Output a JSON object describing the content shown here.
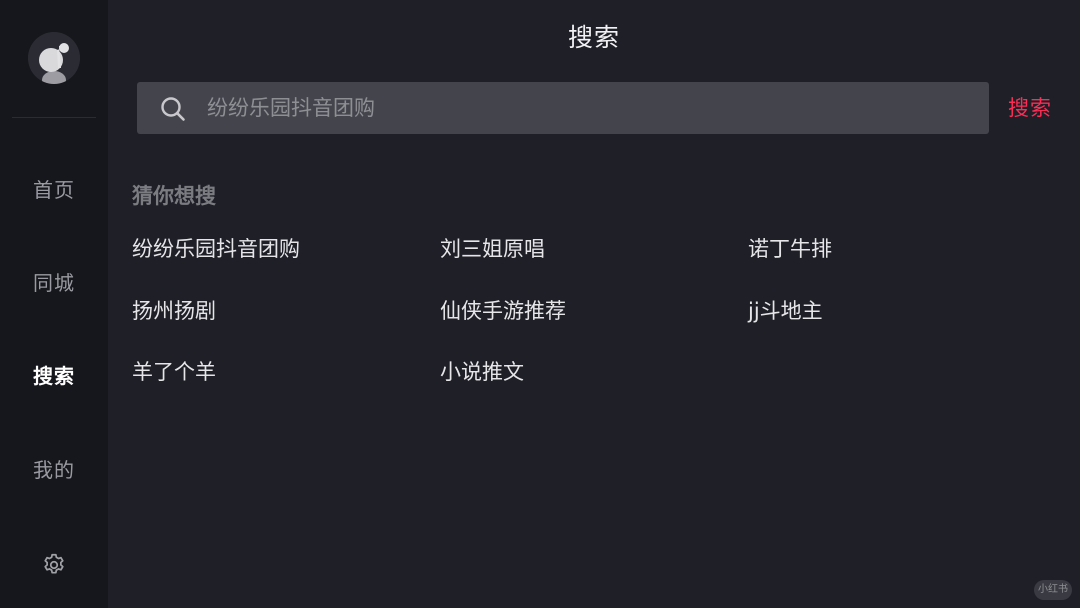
{
  "header": {
    "title": "搜索"
  },
  "sidebar": {
    "avatar_icon": "music-note-avatar-icon",
    "items": [
      {
        "label": "首页",
        "active": false
      },
      {
        "label": "同城",
        "active": false
      },
      {
        "label": "搜索",
        "active": true
      },
      {
        "label": "我的",
        "active": false
      }
    ],
    "settings_icon": "gear-icon"
  },
  "search": {
    "placeholder": "纷纷乐园抖音团购",
    "value": "",
    "button_label": "搜索",
    "icon": "search-icon"
  },
  "suggestions": {
    "title": "猜你想搜",
    "items": [
      "纷纷乐园抖音团购",
      "刘三姐原唱",
      "诺丁牛排",
      "扬州扬剧",
      "仙侠手游推荐",
      "jj斗地主",
      "羊了个羊",
      "小说推文"
    ]
  },
  "watermark": {
    "text": "小红书"
  },
  "colors": {
    "background": "#1e1f27",
    "sidebar": "#16171d",
    "search_box": "#44454c",
    "accent": "#fe2c55"
  }
}
